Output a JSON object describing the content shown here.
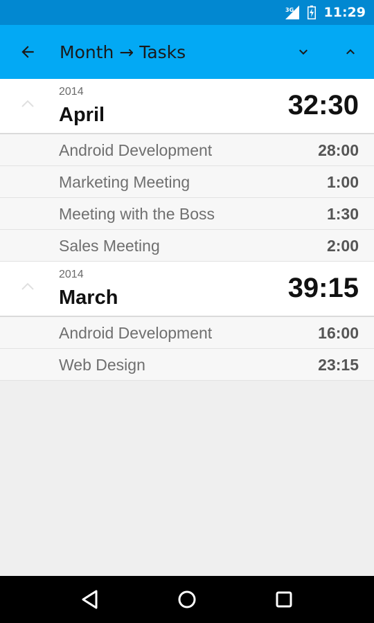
{
  "status_bar": {
    "network": "3G",
    "time": "11:29",
    "signal_icon": "signal-icon",
    "battery_icon": "battery-icon"
  },
  "app_bar": {
    "title": "Month → Tasks",
    "back_icon": "arrow-back-icon",
    "expand_icon": "chevron-down-icon",
    "collapse_icon": "chevron-up-icon"
  },
  "groups": [
    {
      "year": "2014",
      "month": "April",
      "total": "32:30",
      "tasks": [
        {
          "name": "Android Development",
          "duration": "28:00"
        },
        {
          "name": "Marketing Meeting",
          "duration": "1:00"
        },
        {
          "name": "Meeting with the Boss",
          "duration": "1:30"
        },
        {
          "name": "Sales Meeting",
          "duration": "2:00"
        }
      ]
    },
    {
      "year": "2014",
      "month": "March",
      "total": "39:15",
      "tasks": [
        {
          "name": "Android Development",
          "duration": "16:00"
        },
        {
          "name": "Web Design",
          "duration": "23:15"
        }
      ]
    }
  ],
  "nav_bar": {
    "back_icon": "nav-back-icon",
    "home_icon": "nav-home-icon",
    "recents_icon": "nav-recents-icon"
  },
  "colors": {
    "status_bar": "#0288d1",
    "app_bar": "#03a9f4",
    "background": "#efefef"
  }
}
